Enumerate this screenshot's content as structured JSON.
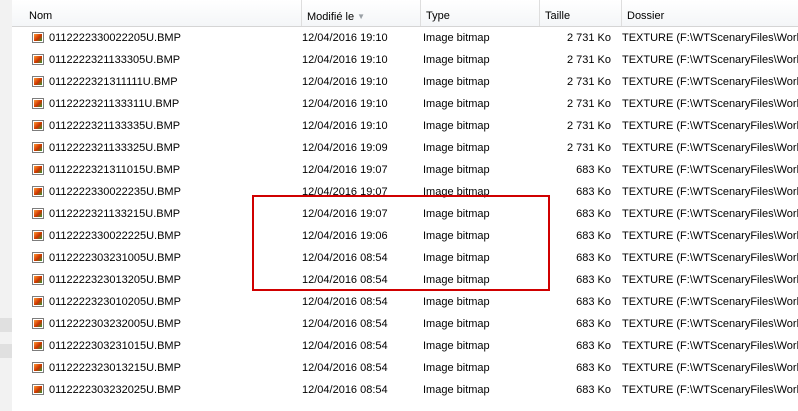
{
  "columns": {
    "name": "Nom",
    "modified": "Modifié le",
    "type": "Type",
    "size": "Taille",
    "folder": "Dossier"
  },
  "icons": {
    "sort": "sort-descending-icon",
    "file": "bitmap-file-icon"
  },
  "colors": {
    "highlight": "#d00000"
  },
  "rows": [
    {
      "name": "0112222330022205U.BMP",
      "modified": "12/04/2016 19:10",
      "type": "Image bitmap",
      "size": "2 731 Ko",
      "folder": "TEXTURE (F:\\WTScenaryFiles\\World"
    },
    {
      "name": "0112222321133305U.BMP",
      "modified": "12/04/2016 19:10",
      "type": "Image bitmap",
      "size": "2 731 Ko",
      "folder": "TEXTURE (F:\\WTScenaryFiles\\World"
    },
    {
      "name": "0112222321311111U.BMP",
      "modified": "12/04/2016 19:10",
      "type": "Image bitmap",
      "size": "2 731 Ko",
      "folder": "TEXTURE (F:\\WTScenaryFiles\\World"
    },
    {
      "name": "0112222321133311U.BMP",
      "modified": "12/04/2016 19:10",
      "type": "Image bitmap",
      "size": "2 731 Ko",
      "folder": "TEXTURE (F:\\WTScenaryFiles\\World"
    },
    {
      "name": "0112222321133335U.BMP",
      "modified": "12/04/2016 19:10",
      "type": "Image bitmap",
      "size": "2 731 Ko",
      "folder": "TEXTURE (F:\\WTScenaryFiles\\World"
    },
    {
      "name": "0112222321133325U.BMP",
      "modified": "12/04/2016 19:09",
      "type": "Image bitmap",
      "size": "2 731 Ko",
      "folder": "TEXTURE (F:\\WTScenaryFiles\\World"
    },
    {
      "name": "0112222321311015U.BMP",
      "modified": "12/04/2016 19:07",
      "type": "Image bitmap",
      "size": "683 Ko",
      "folder": "TEXTURE (F:\\WTScenaryFiles\\World"
    },
    {
      "name": "0112222330022235U.BMP",
      "modified": "12/04/2016 19:07",
      "type": "Image bitmap",
      "size": "683 Ko",
      "folder": "TEXTURE (F:\\WTScenaryFiles\\World"
    },
    {
      "name": "0112222321133215U.BMP",
      "modified": "12/04/2016 19:07",
      "type": "Image bitmap",
      "size": "683 Ko",
      "folder": "TEXTURE (F:\\WTScenaryFiles\\World"
    },
    {
      "name": "0112222330022225U.BMP",
      "modified": "12/04/2016 19:06",
      "type": "Image bitmap",
      "size": "683 Ko",
      "folder": "TEXTURE (F:\\WTScenaryFiles\\World"
    },
    {
      "name": "0112222303231005U.BMP",
      "modified": "12/04/2016 08:54",
      "type": "Image bitmap",
      "size": "683 Ko",
      "folder": "TEXTURE (F:\\WTScenaryFiles\\World"
    },
    {
      "name": "0112222323013205U.BMP",
      "modified": "12/04/2016 08:54",
      "type": "Image bitmap",
      "size": "683 Ko",
      "folder": "TEXTURE (F:\\WTScenaryFiles\\World"
    },
    {
      "name": "0112222323010205U.BMP",
      "modified": "12/04/2016 08:54",
      "type": "Image bitmap",
      "size": "683 Ko",
      "folder": "TEXTURE (F:\\WTScenaryFiles\\World"
    },
    {
      "name": "0112222303232005U.BMP",
      "modified": "12/04/2016 08:54",
      "type": "Image bitmap",
      "size": "683 Ko",
      "folder": "TEXTURE (F:\\WTScenaryFiles\\World"
    },
    {
      "name": "0112222303231015U.BMP",
      "modified": "12/04/2016 08:54",
      "type": "Image bitmap",
      "size": "683 Ko",
      "folder": "TEXTURE (F:\\WTScenaryFiles\\World"
    },
    {
      "name": "0112222323013215U.BMP",
      "modified": "12/04/2016 08:54",
      "type": "Image bitmap",
      "size": "683 Ko",
      "folder": "TEXTURE (F:\\WTScenaryFiles\\World"
    },
    {
      "name": "0112222303232025U.BMP",
      "modified": "12/04/2016 08:54",
      "type": "Image bitmap",
      "size": "683 Ko",
      "folder": "TEXTURE (F:\\WTScenaryFiles\\World"
    }
  ]
}
